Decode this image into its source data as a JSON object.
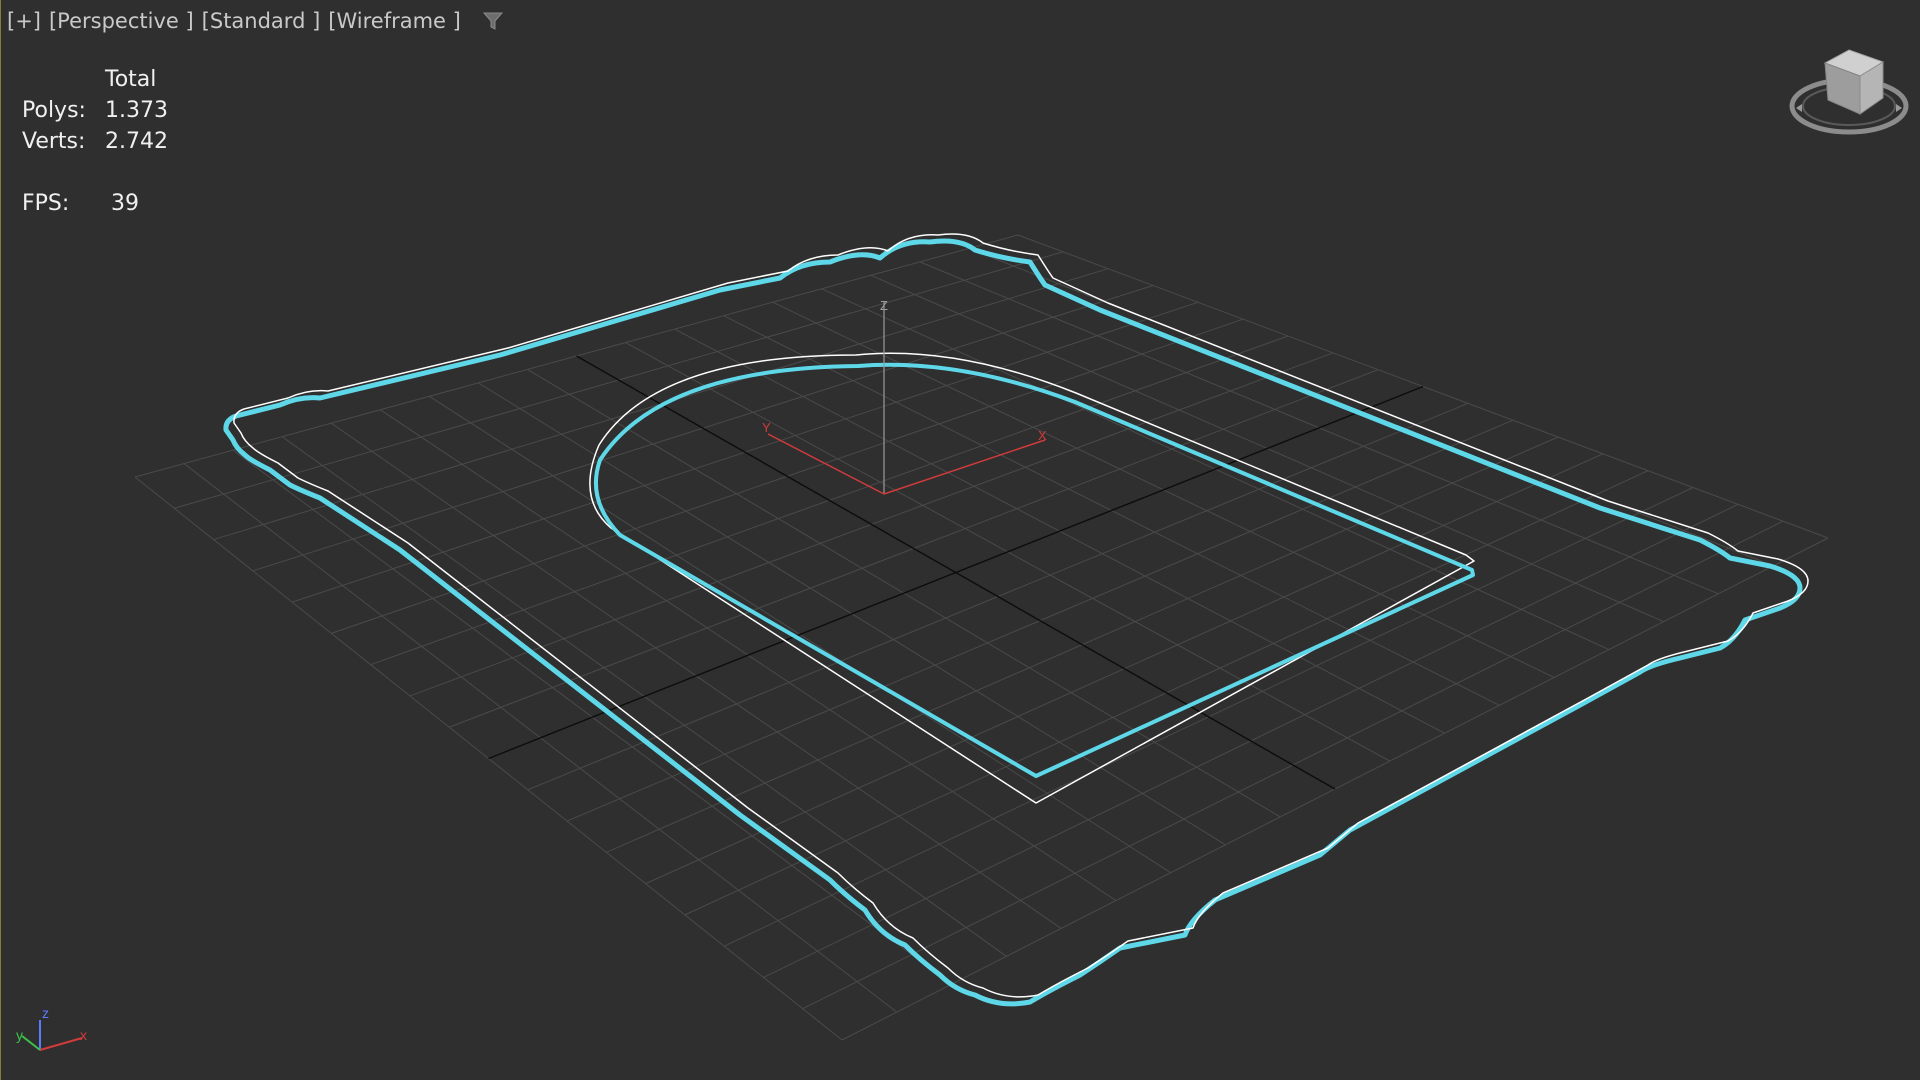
{
  "viewport": {
    "labels": [
      {
        "name": "viewport-menu-button",
        "text": "[+]"
      },
      {
        "name": "view-point-label",
        "text": "[Perspective ]"
      },
      {
        "name": "shading-preset-label",
        "text": "[Standard ]"
      },
      {
        "name": "display-mode-label",
        "text": "[Wireframe ]"
      }
    ],
    "filter_icon": "funnel-icon"
  },
  "stats": {
    "header": "Total",
    "polys_label": "Polys:",
    "polys_value": "1.373",
    "verts_label": "Verts:",
    "verts_value": "2.742",
    "fps_label": "FPS:",
    "fps_value": "39"
  },
  "gizmo": {
    "x_label": "X",
    "y_label": "Y",
    "z_label": "Z"
  },
  "tripod": {
    "x_label": "x",
    "y_label": "y",
    "z_label": "z"
  },
  "colors": {
    "background": "#2f2f2f",
    "grid": "#4a4a4a",
    "selection": "#5ed8e8",
    "wire": "#ffffff",
    "axis_x": "#d23b3b",
    "axis_y": "#3cc24a",
    "axis_z": "#5a7cff"
  }
}
